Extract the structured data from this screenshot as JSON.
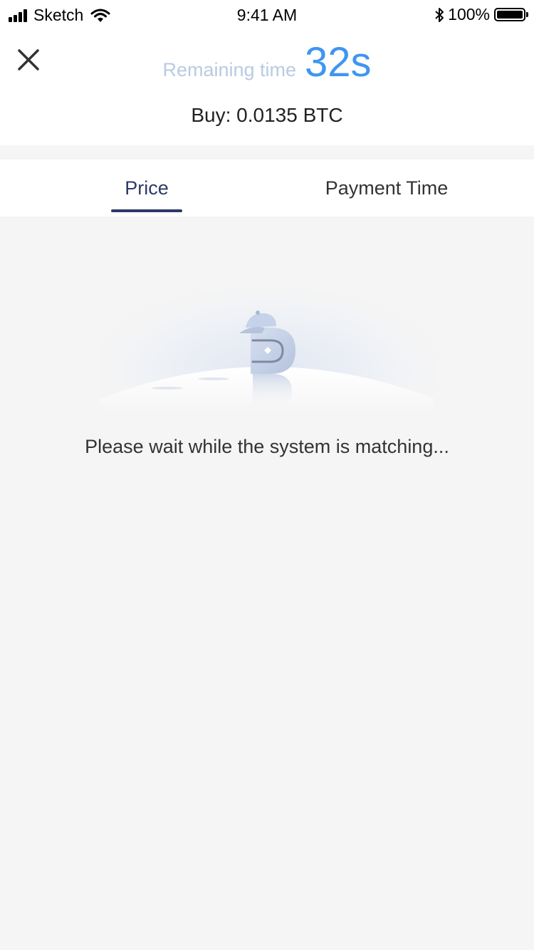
{
  "status_bar": {
    "carrier": "Sketch",
    "time": "9:41 AM",
    "battery": "100%",
    "battery_level": 1.0
  },
  "header": {
    "remaining_label": "Remaining time",
    "remaining_value": "32s",
    "buy_line": "Buy: 0.0135 BTC"
  },
  "tabs": [
    {
      "label": "Price",
      "active": true
    },
    {
      "label": "Payment Time",
      "active": false
    }
  ],
  "main": {
    "message": "Please wait while the system is matching..."
  },
  "colors": {
    "accent": "#3e96f0",
    "tab_active": "#2b3a67",
    "label_light": "#b9cbe2",
    "background": "#f5f5f5"
  },
  "icons": {
    "close": "close-icon",
    "signal": "signal-icon",
    "wifi": "wifi-icon",
    "bluetooth": "bluetooth-icon",
    "battery": "battery-icon",
    "illustration": "matching-illustration"
  }
}
